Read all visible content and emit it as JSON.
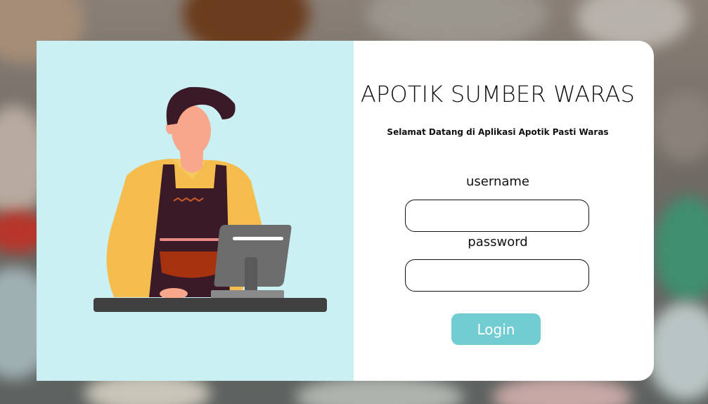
{
  "app": {
    "title": "APOTIK SUMBER WARAS",
    "subtitle": "Selamat Datang di Aplikasi Apotik Pasti Waras"
  },
  "form": {
    "username_label": "username",
    "username_value": "",
    "password_label": "password",
    "password_value": "",
    "login_label": "Login"
  },
  "colors": {
    "left_panel": "#cbf0f4",
    "login_button": "#72cdd3",
    "apron": "#3a1a26",
    "shirt": "#f5bd4e"
  },
  "illustration": "pharmacist-at-cash-register"
}
